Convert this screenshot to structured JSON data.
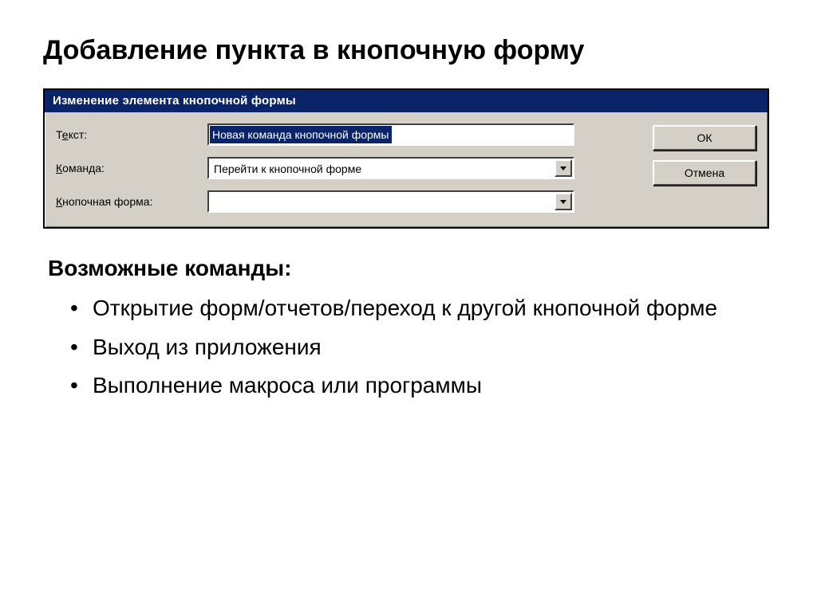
{
  "slide": {
    "title": "Добавление пункта в кнопочную форму"
  },
  "dialog": {
    "title": "Изменение элемента кнопочной формы",
    "fields": {
      "text": {
        "label_pre": "Т",
        "label_ul": "е",
        "label_post": "кст:",
        "value": "Новая команда кнопочной формы"
      },
      "command": {
        "label_pre": "",
        "label_ul": "К",
        "label_post": "оманда:",
        "value": "Перейти к кнопочной форме"
      },
      "form": {
        "label_pre": "",
        "label_ul": "К",
        "label_post": "нопочная форма:",
        "value": ""
      }
    },
    "buttons": {
      "ok": "ОК",
      "cancel": "Отмена"
    }
  },
  "section": {
    "heading": "Возможные команды:",
    "items": [
      "Открытие форм/отчетов/переход к другой кнопочной форме",
      "Выход из приложения",
      "Выполнение макроса или программы"
    ]
  }
}
